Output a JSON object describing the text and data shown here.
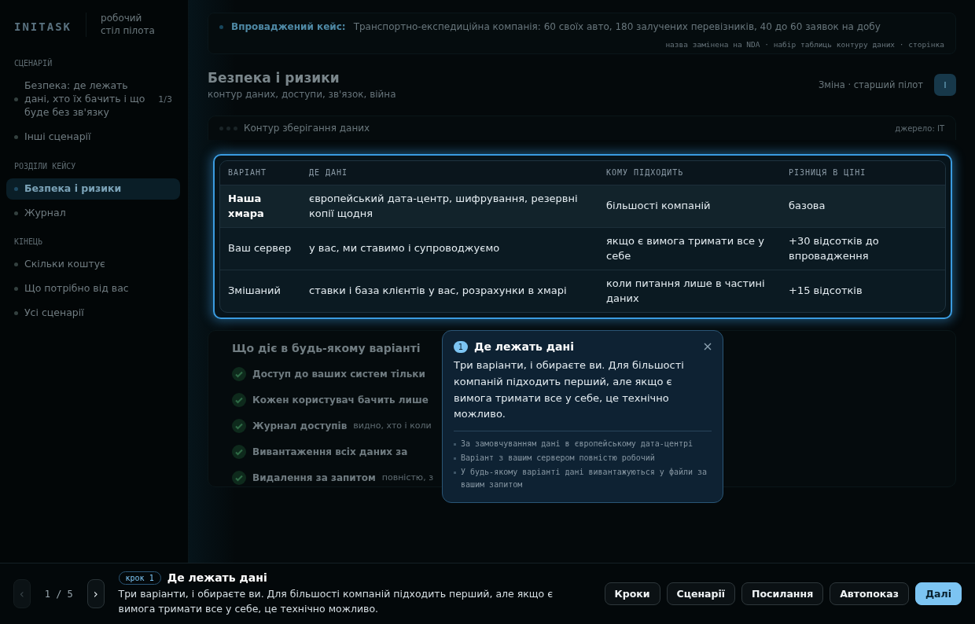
{
  "sidebar": {
    "logo": "INITASK",
    "tagline": "робочий стіл пілота",
    "sections": [
      {
        "title": "СЦЕНАРІЙ",
        "items": [
          {
            "label": "Безпека: де лежать дані, хто їх бачить і що буде без зв'язку",
            "count": "1/3",
            "selected": false
          },
          {
            "label": "Інші сценарії",
            "selected": false
          }
        ]
      },
      {
        "title": "РОЗДІЛИ КЕЙСУ",
        "items": [
          {
            "label": "Безпека і ризики",
            "selected": true
          },
          {
            "label": "Журнал",
            "selected": false
          }
        ]
      },
      {
        "title": "КІНЕЦЬ",
        "items": [
          {
            "label": "Скільки коштує",
            "selected": false
          },
          {
            "label": "Що потрібно від вас",
            "selected": false
          },
          {
            "label": "Усі сценарії",
            "selected": false
          }
        ]
      }
    ]
  },
  "banner": {
    "label": "Впроваджений кейс:",
    "text": "Транспортно-експедиційна компанія: 60 своїх авто, 180 залучених перевізників, 40 до 60 заявок на добу",
    "meta": "назва замінена на NDA · набір таблиць контуру даних · сторінка"
  },
  "page": {
    "title": "Безпека і ризики",
    "subtitle": "контур даних, доступи, зв'язок, війна",
    "role": "Зміна · старший пілот"
  },
  "data_card": {
    "title": "Контур зберігання даних",
    "source": "джерело: ІТ"
  },
  "table": {
    "columns": [
      "ВАРІАНТ",
      "ДЕ ДАНІ",
      "КОМУ ПІДХОДИТЬ",
      "РІЗНИЦЯ В ЦІНІ"
    ],
    "rows": [
      {
        "cells": [
          "Наша хмара",
          "європейський дата-центр, шифрування, резервні копії щодня",
          "більшості компаній",
          "базова"
        ],
        "selected": true
      },
      {
        "cells": [
          "Ваш сервер",
          "у вас, ми ставимо і супроводжуємо",
          "якщо є вимога тримати все у себе",
          "+30 відсотків до впровадження"
        ],
        "selected": false
      },
      {
        "cells": [
          "Змішаний",
          "ставки і база клієнтів у вас, розрахунки в хмарі",
          "коли питання лише в частині даних",
          "+15 відсотків"
        ],
        "selected": false
      }
    ]
  },
  "guarantees": {
    "title": "Що діє в будь-якому варіанті",
    "items": [
      {
        "title": "Доступ до ваших систем тільки"
      },
      {
        "title": "Кожен користувач бачить лише"
      },
      {
        "title": "Журнал доступів",
        "note": "видно, хто і коли"
      },
      {
        "title": "Вивантаження всіх даних за"
      },
      {
        "title": "Видалення за запитом",
        "note": "повністю, з"
      }
    ]
  },
  "tooltip": {
    "step": "1",
    "title": "Де лежать дані",
    "body": "Три варіанти, і обираєте ви. Для більшості компаній підходить перший, але якщо є вимога тримати все у себе, це технічно можливо.",
    "points": [
      "За замовчуванням дані в європейському дата-центрі",
      "Варіант з вашим сервером повністю робочий",
      "У будь-якому варіанті дані вивантажуються у файли за вашим запитом"
    ]
  },
  "footer": {
    "prev": "‹",
    "counter": "1 / 5",
    "next": "›",
    "badge": "крок 1",
    "title": "Де лежать дані",
    "body": "Три варіанти, і обираєте ви. Для більшості компаній підходить перший, але якщо є вимога тримати все у себе, це технічно можливо.",
    "buttons": [
      {
        "label": "Кроки",
        "primary": false
      },
      {
        "label": "Сценарії",
        "primary": false
      },
      {
        "label": "Посилання",
        "primary": false
      },
      {
        "label": "Автопоказ",
        "primary": false
      },
      {
        "label": "Далі",
        "primary": true
      }
    ]
  }
}
